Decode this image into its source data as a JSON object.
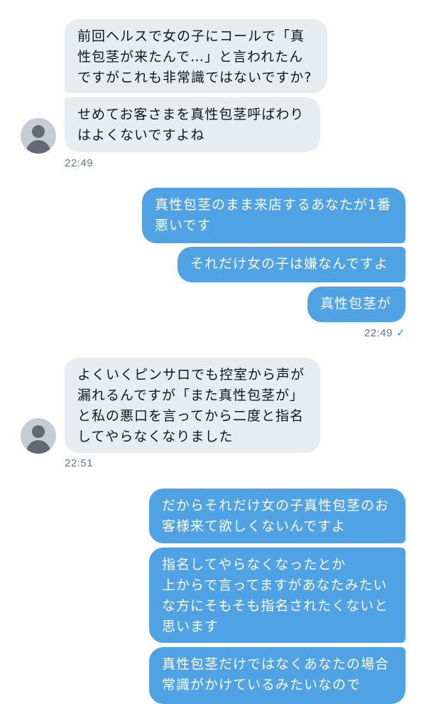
{
  "conversation": {
    "group1": {
      "messages": [
        "前回ヘルスで女の子にコールで「真\n性包茎が来たんで…」と言われたん\nですがこれも非常識ではないですか?",
        "せめてお客さまを真性包茎呼ばわり\nはよくないですよね"
      ],
      "time": "22:49"
    },
    "group2": {
      "messages": [
        "真性包茎のまま来店するあなたが1番\n悪いです",
        "それだけ女の子は嫌なんですよ",
        "真性包茎が"
      ],
      "time": "22:49",
      "read_icon": "✓"
    },
    "group3": {
      "messages": [
        "よくいくピンサロでも控室から声が\n漏れるんですが「また真性包茎が」\nと私の悪口を言ってから二度と指名\nしてやらなくなりました"
      ],
      "time": "22:51"
    },
    "group4": {
      "messages": [
        "だからそれだけ女の子真性包茎のお\n客様来て欲しくないんですよ",
        "指名してやらなくなったとか\n上からで言ってますがあなたみたい\nな方にそもそも指名されたくないと\n思います",
        "真性包茎だけではなくあなたの場合\n常識がかけているみたいなので"
      ]
    }
  },
  "colors": {
    "incoming_bubble": "#e6ecf0",
    "outgoing_bubble": "#4fa3e5",
    "timestamp": "#657786",
    "read_check": "#1da1f2"
  },
  "icons": {
    "avatar": "default-avatar-icon",
    "read": "checkmark-icon"
  }
}
